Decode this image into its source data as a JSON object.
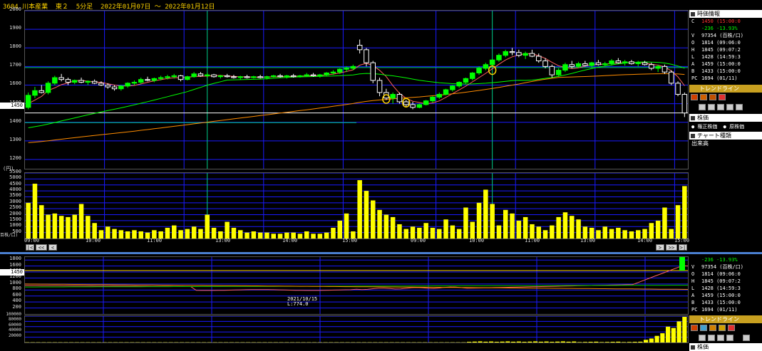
{
  "title": "3604 川本産業  東２  5分足  2022年01月07日 ～ 2022年01月12日",
  "current_price_label": "1450",
  "colors": {
    "up": "#00ff00",
    "down": "#ffffff",
    "volume": "#ffff00",
    "grid": "#1a1aff",
    "ma_short": "#ff6060",
    "ma_mid": "#00ff00",
    "ma_long": "#ff8c00",
    "cursor": "#00cc88"
  },
  "main_chart": {
    "y_ticks": [
      "2000",
      "1900",
      "1800",
      "1700",
      "1600",
      "1500",
      "1400",
      "1300",
      "1200"
    ],
    "ylim": [
      1150,
      2000
    ],
    "x_ticks": [
      "09:00",
      "10:00",
      "11:00",
      "13:00",
      "14:00",
      "15:00",
      "09:00",
      "10:00",
      "11:00",
      "13:00",
      "14:00",
      "15:00"
    ],
    "unit_label": "(円)"
  },
  "volume_chart": {
    "y_ticks": [
      "5500",
      "5000",
      "4500",
      "4000",
      "3500",
      "3000",
      "2500",
      "2000",
      "1500",
      "1000",
      "500"
    ],
    "unit_label": "百株/口)",
    "ymax": 5500
  },
  "nav": {
    "first": "|<",
    "prev_page": "<<",
    "prev": "<",
    "next": ">",
    "next_page": ">>",
    "last": ">|"
  },
  "lower_chart": {
    "y_ticks": [
      "1800",
      "1600",
      "1400",
      "1200",
      "1000",
      "800",
      "600",
      "400",
      "200"
    ],
    "annotation_date": "2021/10/15",
    "annotation_low": "L:774.0",
    "vol_ticks": [
      "100000",
      "80000",
      "60000",
      "40000",
      "20000"
    ]
  },
  "side_panel": {
    "header": "時価情報",
    "rows": [
      {
        "k": "C",
        "v": "1450 (15:00:0",
        "color": "#ff3030"
      },
      {
        "k": "",
        "v": "-236 -13.93%",
        "color": "#00ff00"
      },
      {
        "k": "V",
        "v": "97354 (百株/口)",
        "color": "#ffffff"
      },
      {
        "k": "O",
        "v": "1814 (09:06:0",
        "color": "#ffffff"
      },
      {
        "k": "H",
        "v": "1845 (09:07:2",
        "color": "#ffffff"
      },
      {
        "k": "L",
        "v": "1428 (14:59:3",
        "color": "#ffffff"
      },
      {
        "k": "A",
        "v": "1459 (15:00:0",
        "color": "#ffffff"
      },
      {
        "k": "B",
        "v": "1433 (15:00:0",
        "color": "#ffffff"
      },
      {
        "k": "PC",
        "v": "1694 (01/11)",
        "color": "#ffffff"
      }
    ],
    "trend_header": "トレンドライン",
    "stock_header": "株価",
    "radio_adjusted": "権正株価",
    "radio_original": "原株価",
    "chart_type_header": "チャート種類",
    "chart_type_value": "出来高"
  },
  "lower_side": {
    "rows": [
      {
        "k": "",
        "v": "-236 -13.93%",
        "color": "#00ff00"
      },
      {
        "k": "V",
        "v": "97354 (百株/口)",
        "color": "#ffffff"
      },
      {
        "k": "O",
        "v": "1814 (09:06:0",
        "color": "#ffffff"
      },
      {
        "k": "H",
        "v": "1845 (09:07:2",
        "color": "#ffffff"
      },
      {
        "k": "L",
        "v": "1428 (14:59:3",
        "color": "#ffffff"
      },
      {
        "k": "A",
        "v": "1459 (15:00:0",
        "color": "#ffffff"
      },
      {
        "k": "B",
        "v": "1433 (15:00:0",
        "color": "#ffffff"
      },
      {
        "k": "PC",
        "v": "1694 (01/11)",
        "color": "#ffffff"
      }
    ],
    "trend_header": "トレンドライン",
    "bottom_header": "株価"
  },
  "chart_data": {
    "type": "candlestick",
    "interval": "5分",
    "sessions": [
      "2022-01-11",
      "2022-01-12"
    ],
    "ohlc": [
      [
        1480,
        1560,
        1470,
        1545
      ],
      [
        1545,
        1590,
        1530,
        1570
      ],
      [
        1570,
        1600,
        1555,
        1560
      ],
      [
        1560,
        1620,
        1550,
        1610
      ],
      [
        1610,
        1650,
        1600,
        1640
      ],
      [
        1640,
        1660,
        1620,
        1630
      ],
      [
        1630,
        1640,
        1600,
        1615
      ],
      [
        1615,
        1630,
        1605,
        1625
      ],
      [
        1625,
        1640,
        1610,
        1615
      ],
      [
        1615,
        1625,
        1600,
        1620
      ],
      [
        1620,
        1630,
        1605,
        1610
      ],
      [
        1610,
        1620,
        1595,
        1600
      ],
      [
        1600,
        1610,
        1580,
        1590
      ],
      [
        1590,
        1600,
        1570,
        1580
      ],
      [
        1580,
        1600,
        1570,
        1595
      ],
      [
        1595,
        1615,
        1585,
        1610
      ],
      [
        1610,
        1625,
        1600,
        1615
      ],
      [
        1615,
        1640,
        1605,
        1630
      ],
      [
        1630,
        1645,
        1620,
        1625
      ],
      [
        1625,
        1640,
        1615,
        1635
      ],
      [
        1635,
        1650,
        1625,
        1640
      ],
      [
        1640,
        1655,
        1630,
        1645
      ],
      [
        1645,
        1660,
        1635,
        1650
      ],
      [
        1650,
        1655,
        1620,
        1630
      ],
      [
        1630,
        1650,
        1625,
        1645
      ],
      [
        1645,
        1670,
        1640,
        1660
      ],
      [
        1660,
        1670,
        1645,
        1650
      ],
      [
        1650,
        1665,
        1640,
        1655
      ],
      [
        1655,
        1660,
        1640,
        1645
      ],
      [
        1645,
        1655,
        1635,
        1650
      ],
      [
        1650,
        1660,
        1640,
        1645
      ],
      [
        1645,
        1655,
        1635,
        1640
      ],
      [
        1640,
        1650,
        1630,
        1645
      ],
      [
        1645,
        1655,
        1635,
        1640
      ],
      [
        1640,
        1650,
        1635,
        1645
      ],
      [
        1645,
        1655,
        1635,
        1640
      ],
      [
        1640,
        1650,
        1630,
        1645
      ],
      [
        1645,
        1655,
        1640,
        1650
      ],
      [
        1650,
        1660,
        1640,
        1645
      ],
      [
        1645,
        1655,
        1635,
        1650
      ],
      [
        1650,
        1660,
        1640,
        1645
      ],
      [
        1645,
        1655,
        1640,
        1650
      ],
      [
        1650,
        1665,
        1645,
        1655
      ],
      [
        1655,
        1665,
        1645,
        1650
      ],
      [
        1650,
        1660,
        1640,
        1655
      ],
      [
        1655,
        1670,
        1650,
        1665
      ],
      [
        1665,
        1680,
        1655,
        1670
      ],
      [
        1670,
        1690,
        1660,
        1685
      ],
      [
        1685,
        1700,
        1670,
        1690
      ],
      [
        1690,
        1710,
        1680,
        1700
      ],
      [
        1814,
        1845,
        1770,
        1790
      ],
      [
        1790,
        1800,
        1700,
        1720
      ],
      [
        1720,
        1730,
        1610,
        1625
      ],
      [
        1625,
        1640,
        1540,
        1560
      ],
      [
        1560,
        1580,
        1520,
        1530
      ],
      [
        1530,
        1560,
        1500,
        1550
      ],
      [
        1550,
        1560,
        1500,
        1510
      ],
      [
        1510,
        1520,
        1480,
        1495
      ],
      [
        1495,
        1510,
        1470,
        1480
      ],
      [
        1480,
        1500,
        1475,
        1495
      ],
      [
        1495,
        1520,
        1490,
        1515
      ],
      [
        1515,
        1540,
        1505,
        1535
      ],
      [
        1535,
        1560,
        1525,
        1550
      ],
      [
        1550,
        1580,
        1545,
        1575
      ],
      [
        1575,
        1600,
        1565,
        1595
      ],
      [
        1595,
        1620,
        1585,
        1615
      ],
      [
        1615,
        1640,
        1605,
        1635
      ],
      [
        1635,
        1670,
        1625,
        1665
      ],
      [
        1665,
        1700,
        1655,
        1690
      ],
      [
        1690,
        1720,
        1680,
        1710
      ],
      [
        1710,
        1740,
        1700,
        1735
      ],
      [
        1735,
        1770,
        1725,
        1760
      ],
      [
        1760,
        1790,
        1750,
        1780
      ],
      [
        1780,
        1800,
        1760,
        1775
      ],
      [
        1775,
        1790,
        1750,
        1760
      ],
      [
        1760,
        1780,
        1740,
        1770
      ],
      [
        1770,
        1790,
        1750,
        1755
      ],
      [
        1755,
        1770,
        1720,
        1730
      ],
      [
        1730,
        1745,
        1690,
        1700
      ],
      [
        1700,
        1710,
        1640,
        1655
      ],
      [
        1655,
        1690,
        1645,
        1680
      ],
      [
        1680,
        1720,
        1670,
        1710
      ],
      [
        1710,
        1730,
        1690,
        1700
      ],
      [
        1700,
        1725,
        1690,
        1715
      ],
      [
        1715,
        1730,
        1700,
        1705
      ],
      [
        1705,
        1725,
        1695,
        1720
      ],
      [
        1720,
        1735,
        1705,
        1710
      ],
      [
        1710,
        1725,
        1700,
        1715
      ],
      [
        1715,
        1740,
        1705,
        1730
      ],
      [
        1730,
        1745,
        1715,
        1720
      ],
      [
        1720,
        1735,
        1705,
        1725
      ],
      [
        1725,
        1735,
        1710,
        1715
      ],
      [
        1715,
        1730,
        1700,
        1720
      ],
      [
        1720,
        1730,
        1705,
        1710
      ],
      [
        1710,
        1720,
        1680,
        1690
      ],
      [
        1690,
        1710,
        1670,
        1700
      ],
      [
        1700,
        1710,
        1660,
        1670
      ],
      [
        1670,
        1680,
        1600,
        1610
      ],
      [
        1610,
        1620,
        1540,
        1550
      ],
      [
        1550,
        1560,
        1428,
        1450
      ]
    ],
    "volume": [
      3000,
      4600,
      2800,
      2000,
      2100,
      1900,
      1800,
      2000,
      2900,
      1900,
      1300,
      700,
      1000,
      800,
      700,
      600,
      700,
      600,
      500,
      700,
      600,
      900,
      1100,
      700,
      800,
      1000,
      800,
      2000,
      900,
      600,
      1400,
      900,
      700,
      500,
      600,
      500,
      500,
      400,
      400,
      500,
      500,
      400,
      600,
      400,
      400,
      500,
      900,
      1500,
      2100,
      600,
      4900,
      4000,
      3200,
      2400,
      2000,
      1800,
      1200,
      800,
      1000,
      900,
      1300,
      900,
      800,
      1600,
      1100,
      800,
      2600,
      1400,
      3000,
      4100,
      2900,
      1100,
      2400,
      2100,
      1500,
      1800,
      1200,
      1000,
      700,
      1100,
      1800,
      2200,
      1900,
      1600,
      1000,
      900,
      700,
      1000,
      800,
      900,
      700,
      600,
      700,
      800,
      1300,
      1500,
      2600,
      800,
      2800,
      4400
    ],
    "ylim": [
      1150,
      2000
    ],
    "x_tick_labels": [
      "09:00",
      "10:00",
      "11:00",
      "13:00",
      "14:00",
      "15:00",
      "09:00",
      "10:00",
      "11:00",
      "13:00",
      "14:00",
      "15:00"
    ]
  }
}
